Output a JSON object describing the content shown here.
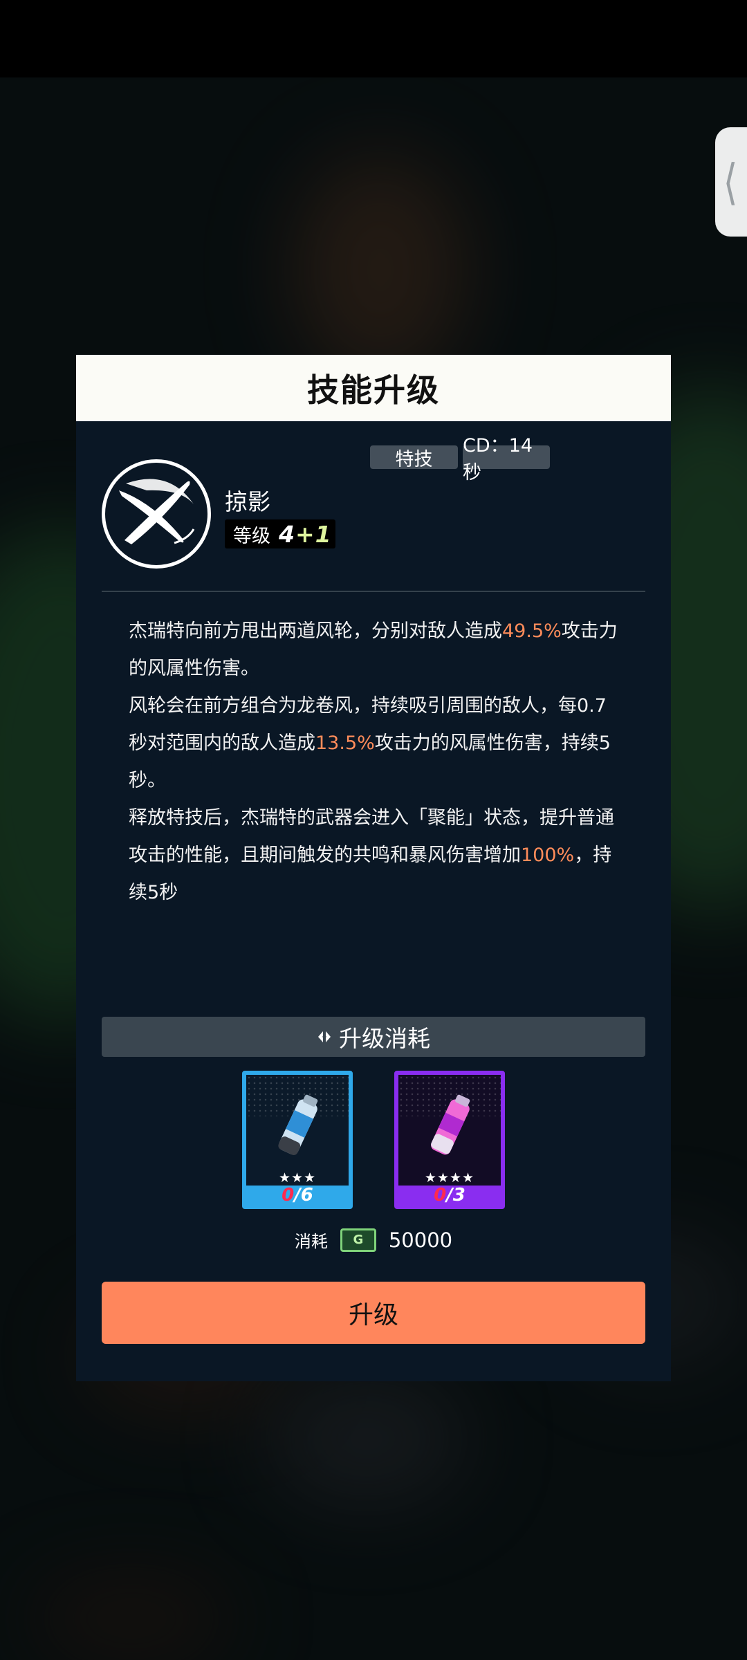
{
  "dialog": {
    "title": "技能升级",
    "back_icon": "chevron-left-icon"
  },
  "skill": {
    "type_tag": "特技",
    "cd_tag": "CD：14秒",
    "name": "掠影",
    "level_label": "等级",
    "level_base": "4",
    "level_bonus": "+1",
    "icon": "crossed-blades-icon"
  },
  "description": [
    [
      {
        "text": "杰瑞特向前方甩出两道风轮，分别对敌人造成",
        "hl": false
      },
      {
        "text": "49.5%",
        "hl": true
      },
      {
        "text": "攻击力的风属性伤害。",
        "hl": false
      }
    ],
    [
      {
        "text": "风轮会在前方组合为龙卷风，持续吸引周围的敌人，每0.7秒对范围内的敌人造成",
        "hl": false
      },
      {
        "text": "13.5%",
        "hl": true
      },
      {
        "text": "攻击力的风属性伤害，持续5秒。",
        "hl": false
      }
    ],
    [
      {
        "text": "释放特技后，杰瑞特的武器会进入「聚能」状态，提升普通攻击的性能，且期间触发的共鸣和暴风伤害增加",
        "hl": false
      },
      {
        "text": "100%",
        "hl": true
      },
      {
        "text": "，持续5秒",
        "hl": false
      }
    ]
  ],
  "cost": {
    "title": "升级消耗",
    "title_icon": "diamond-arrows-icon",
    "items": [
      {
        "stars": "★★★",
        "owned": "0",
        "need": "/6",
        "color": "#2fa9ea",
        "icon": "blue-canister-icon"
      },
      {
        "stars": "★★★★",
        "owned": "0",
        "need": "/3",
        "color": "#8a2df0",
        "icon": "purple-canister-icon"
      }
    ],
    "coin_label": "消耗",
    "coin_icon": "G",
    "coin_value": "50000"
  },
  "actions": {
    "upgrade_label": "升级"
  },
  "colors": {
    "highlight": "#ff8c5a",
    "button": "#ff865c",
    "panel": "#0a1725"
  }
}
